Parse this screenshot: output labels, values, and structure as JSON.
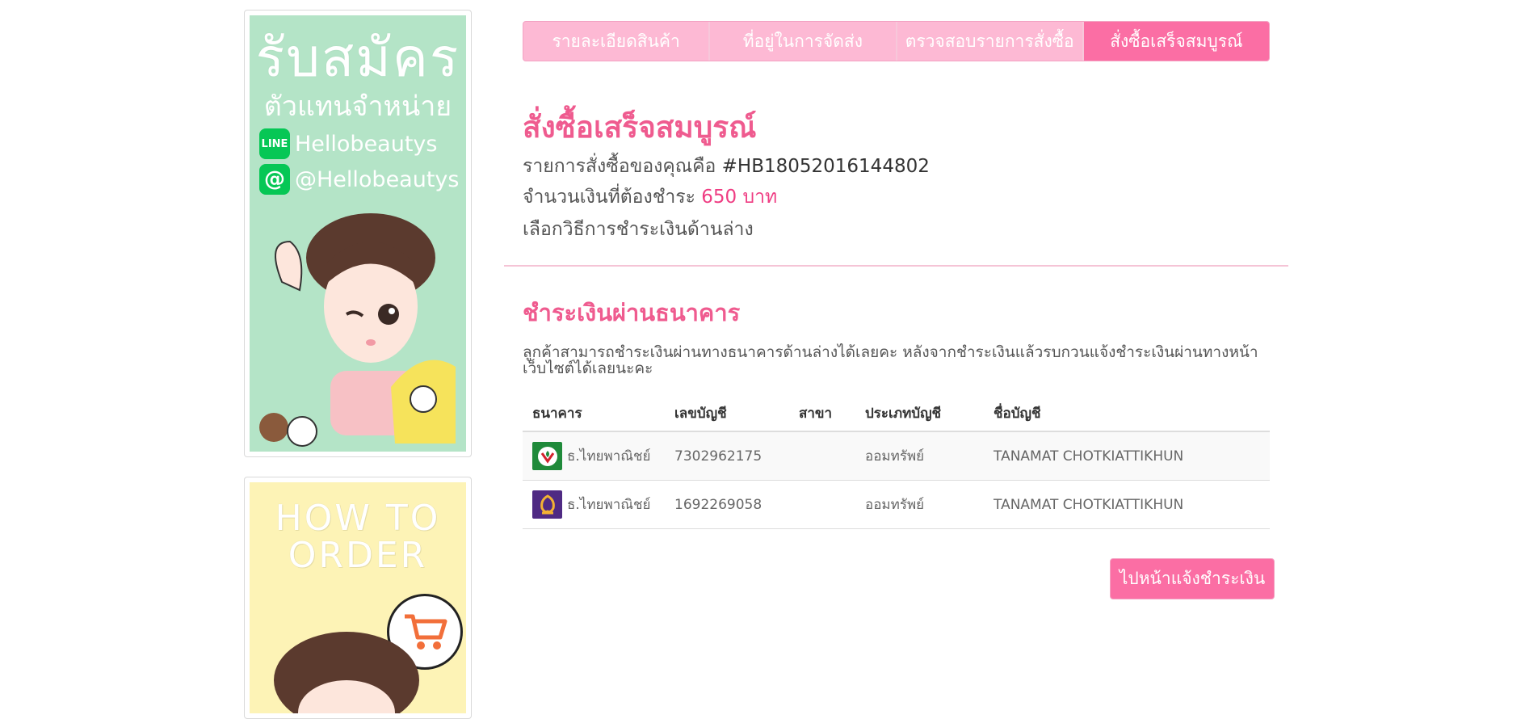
{
  "sidebar": {
    "promo": {
      "title": "รับสมัคร",
      "subtitle": "ตัวแทนจำหน่าย",
      "line_id": "Hellobeautys",
      "at_id": "@Hellobeautys"
    },
    "how_to": {
      "title_line1": "HOW TO",
      "title_line2": "ORDER"
    }
  },
  "steps": [
    {
      "label": "รายละเอียดสินค้า",
      "active": false
    },
    {
      "label": "ที่อยู่ในการจัดส่ง",
      "active": false
    },
    {
      "label": "ตรวจสอบรายการสั่งซื้อ",
      "active": false
    },
    {
      "label": "สั่งซื้อเสร็จสมบูรณ์",
      "active": true
    }
  ],
  "order": {
    "title": "สั่งซื้อเสร็จสมบูรณ์",
    "order_label": "รายการสั่งซื้อของคุณคือ",
    "order_number": "#HB18052016144802",
    "amount_label": "จำนวนเงินที่ต้องชำระ",
    "amount_value": "650 บาท",
    "choose_method": "เลือกวิธีการชำระเงินด้านล่าง"
  },
  "bank_section": {
    "title": "ชำระเงินผ่านธนาคาร",
    "description": "ลูกค้าสามารถชำระเงินผ่านทางธนาคารด้านล่างได้เลยคะ หลังจากชำระเงินแล้วรบกวนแจ้งชำระเงินผ่านทางหน้าเว็บไซต์ได้เลยนะคะ",
    "columns": [
      "ธนาคาร",
      "เลขบัญชี",
      "สาขา",
      "ประเภทบัญชี",
      "ชื่อบัญชี"
    ],
    "rows": [
      {
        "bank": "ธ.ไทยพาณิชย์",
        "logo": "kbank-logo",
        "account_no": "7302962175",
        "branch": "",
        "type": "ออมทรัพย์",
        "name": "TANAMAT CHOTKIATTIKHUN"
      },
      {
        "bank": "ธ.ไทยพาณิชย์",
        "logo": "scb-logo",
        "account_no": "1692269058",
        "branch": "",
        "type": "ออมทรัพย์",
        "name": "TANAMAT CHOTKIATTIKHUN"
      }
    ]
  },
  "actions": {
    "notify_payment": "ไปหน้าแจ้งชำระเงิน"
  },
  "colors": {
    "accent": "#fb6ea4",
    "accent_light": "#fdb9d4",
    "title_pink": "#ef5b8f",
    "amount_pink": "#ef3d83"
  }
}
